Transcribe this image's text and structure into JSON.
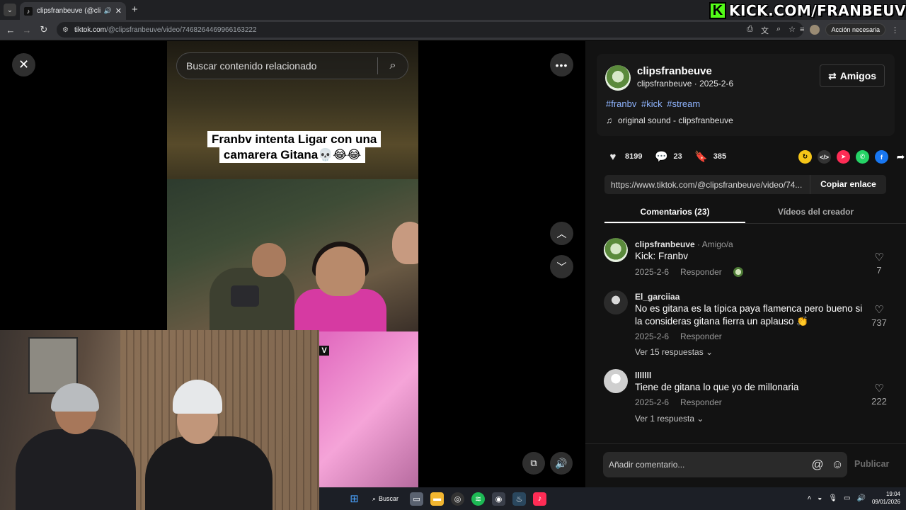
{
  "browser": {
    "tab_title": "clipsfranbeuve (@clipsfranb",
    "tab_favicon": "tiktok-icon",
    "url_host": "tiktok.com",
    "url_path": "/@clipsfranbeuve/video/7468264469966163222",
    "action_label": "Acción necesaria"
  },
  "overlay": {
    "kick_text": "KICK.COM/FRANBEUVE",
    "kick_logo": "K"
  },
  "video": {
    "search_placeholder": "Buscar contenido relacionado",
    "caption": "Franbv intenta Ligar con una camarera Gitana💀😂😂"
  },
  "panel": {
    "author_name": "clipsfranbeuve",
    "author_handle": "clipsfranbeuve",
    "author_date": "2025-2-6",
    "friends_label": "Amigos",
    "hashtags": [
      "#franbv",
      "#kick",
      "#stream"
    ],
    "sound": "original sound - clipsfranbeuve",
    "likes": "8199",
    "comments_count": "23",
    "saves": "385",
    "link": "https://www.tiktok.com/@clipsfranbeuve/video/74...",
    "copy_label": "Copiar enlace",
    "tab_comments": "Comentarios (23)",
    "tab_creator": "Vídeos del creador",
    "comment_placeholder": "Añadir comentario...",
    "publish_label": "Publicar"
  },
  "comments": [
    {
      "name": "clipsfranbeuve",
      "tag": " · Amigo/a",
      "text": "Kick: Franbv",
      "date": "2025-2-6",
      "reply": "Responder",
      "likes": "7"
    },
    {
      "name": "El_garciiaa",
      "tag": "",
      "text": "No es gitana es la típica paya flamenca pero bueno si la consideras gitana fierra un aplauso 👏",
      "date": "2025-2-6",
      "reply": "Responder",
      "likes": "737",
      "replies": "Ver 15 respuestas"
    },
    {
      "name": "lllllll",
      "tag": "",
      "text": "Tiene de gitana lo que yo de millonaria",
      "date": "2025-2-6",
      "reply": "Responder",
      "likes": "222",
      "replies": "Ver 1 respuesta"
    }
  ],
  "taskbar": {
    "search_label": "Buscar",
    "time": "19:04",
    "date": "09/01/2026"
  },
  "colors": {
    "kick_green": "#53fc18",
    "hashtag_blue": "#8fb4ff",
    "panel_bg": "#121212"
  }
}
